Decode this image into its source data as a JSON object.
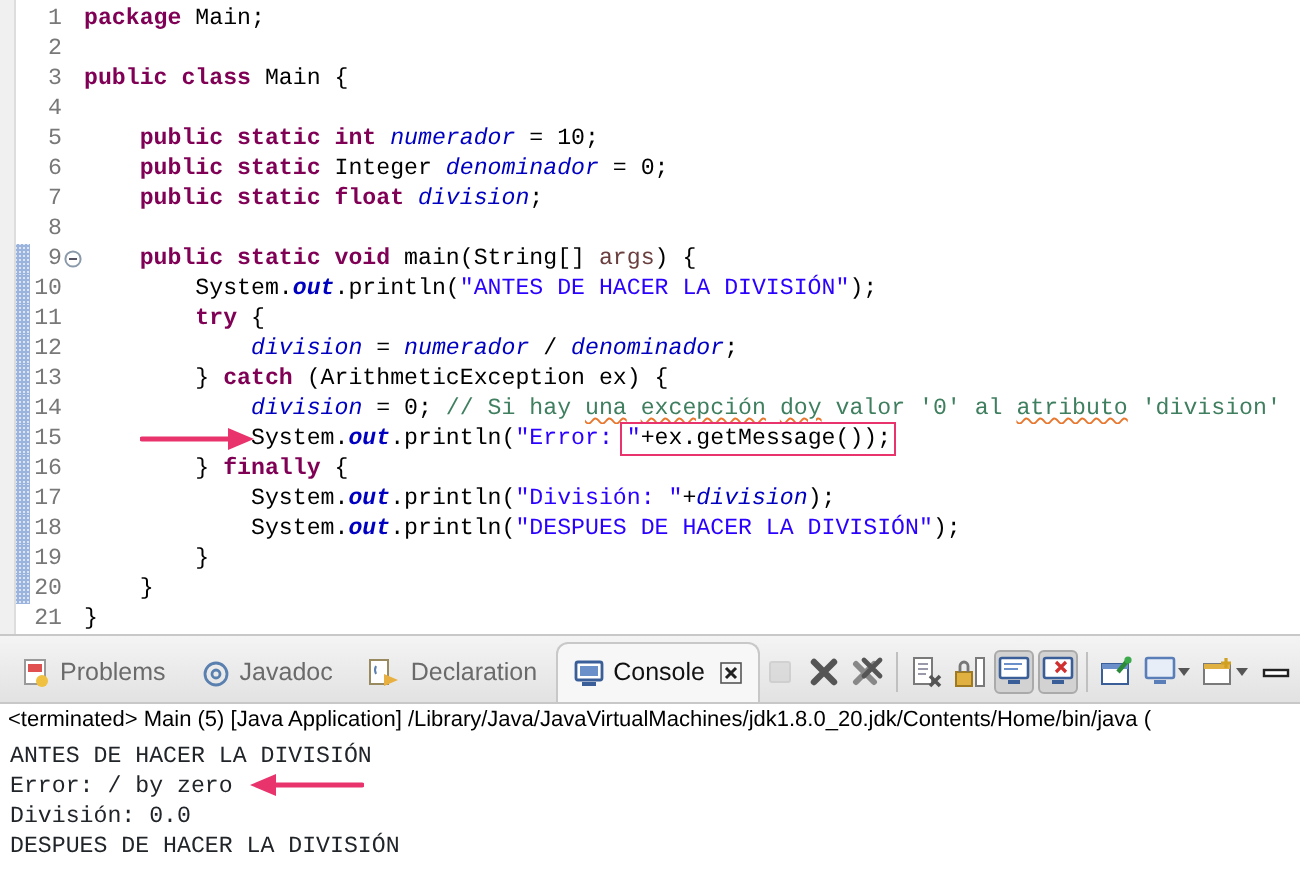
{
  "editor": {
    "lines": [
      {
        "number": "1",
        "marked": false,
        "fold": false,
        "arrow": false,
        "tokens": [
          {
            "text": "package",
            "kind": "keyword"
          },
          {
            "text": " Main;",
            "kind": "plain"
          }
        ]
      },
      {
        "number": "2",
        "marked": false,
        "fold": false,
        "arrow": false
      },
      {
        "number": "3",
        "marked": false,
        "fold": false,
        "arrow": false,
        "tokens": [
          {
            "text": "public class",
            "kind": "keyword"
          },
          {
            "text": " Main {",
            "kind": "plain"
          }
        ]
      },
      {
        "number": "4",
        "marked": false,
        "fold": false,
        "arrow": false
      },
      {
        "number": "5",
        "marked": false,
        "fold": false,
        "arrow": false,
        "tokens": [
          {
            "text": "\tpublic static int",
            "kind": "keyword"
          },
          {
            "text": " numerador",
            "kind": "field"
          },
          {
            "text": " = 10;",
            "kind": "plain"
          }
        ]
      },
      {
        "number": "6",
        "marked": false,
        "fold": false,
        "arrow": false,
        "tokens": [
          {
            "text": "\tpublic static",
            "kind": "keyword"
          },
          {
            "text": " Integer ",
            "kind": "plain"
          },
          {
            "text": "denominador",
            "kind": "field"
          },
          {
            "text": " = 0;",
            "kind": "plain"
          }
        ]
      },
      {
        "number": "7",
        "marked": false,
        "fold": false,
        "arrow": false,
        "tokens": [
          {
            "text": "\tpublic static float",
            "kind": "keyword"
          },
          {
            "text": " division",
            "kind": "field"
          },
          {
            "text": ";",
            "kind": "plain"
          }
        ]
      },
      {
        "number": "8",
        "marked": false,
        "fold": false,
        "arrow": false
      },
      {
        "number": "9",
        "marked": true,
        "fold": true,
        "arrow": false,
        "tokens": [
          {
            "text": "\tpublic static void",
            "kind": "keyword"
          },
          {
            "text": " main(String[] ",
            "kind": "plain"
          },
          {
            "text": "args",
            "kind": "param"
          },
          {
            "text": ") {",
            "kind": "plain"
          }
        ]
      },
      {
        "number": "10",
        "marked": true,
        "fold": false,
        "arrow": false,
        "tokens": [
          {
            "text": "\t\tSystem.",
            "kind": "plain"
          },
          {
            "text": "out",
            "kind": "static"
          },
          {
            "text": ".println(",
            "kind": "plain"
          },
          {
            "text": "\"ANTES DE HACER LA DIVISIÓN\"",
            "kind": "string"
          },
          {
            "text": ");",
            "kind": "plain"
          }
        ]
      },
      {
        "number": "11",
        "marked": true,
        "fold": false,
        "arrow": false,
        "tokens": [
          {
            "text": "\t\ttry",
            "kind": "keyword"
          },
          {
            "text": " {",
            "kind": "plain"
          }
        ]
      },
      {
        "number": "12",
        "marked": true,
        "fold": false,
        "arrow": false,
        "tokens": [
          {
            "text": "\t\t\tdivision",
            "kind": "field"
          },
          {
            "text": " = ",
            "kind": "plain"
          },
          {
            "text": "numerador",
            "kind": "field"
          },
          {
            "text": " / ",
            "kind": "plain"
          },
          {
            "text": "denominador",
            "kind": "field"
          },
          {
            "text": ";",
            "kind": "plain"
          }
        ]
      },
      {
        "number": "13",
        "marked": true,
        "fold": false,
        "arrow": false,
        "tokens": [
          {
            "text": "\t\t} ",
            "kind": "plain"
          },
          {
            "text": "catch",
            "kind": "keyword"
          },
          {
            "text": " (ArithmeticException ex) {",
            "kind": "plain"
          }
        ]
      },
      {
        "number": "14",
        "marked": true,
        "fold": false,
        "arrow": false,
        "tokens": [
          {
            "text": "\t\t\tdivision",
            "kind": "field"
          },
          {
            "text": " = 0; ",
            "kind": "plain"
          },
          {
            "text": "// Si hay ",
            "kind": "comment",
            "misspelled": false
          },
          {
            "text": "una ",
            "kind": "comment",
            "misspelled": true
          },
          {
            "text": "excepción ",
            "kind": "comment",
            "misspelled": true
          },
          {
            "text": "doy",
            "kind": "comment",
            "misspelled": true
          },
          {
            "text": " valor '0' al ",
            "kind": "comment",
            "misspelled": false
          },
          {
            "text": "atributo",
            "kind": "comment",
            "misspelled": true
          },
          {
            "text": " 'division'",
            "kind": "comment",
            "misspelled": false
          }
        ]
      },
      {
        "number": "15",
        "marked": true,
        "fold": false,
        "arrow": true,
        "tokens": [
          {
            "text": "\t\t\tSystem.",
            "kind": "plain"
          },
          {
            "text": "out",
            "kind": "static"
          },
          {
            "text": ".println(",
            "kind": "plain"
          },
          {
            "text": "\"Error: ",
            "kind": "string",
            "boxed": false
          },
          {
            "text": "\"",
            "kind": "string",
            "boxed": true
          },
          {
            "text": "+ex.getMessage());",
            "kind": "plain",
            "boxed": true
          }
        ]
      },
      {
        "number": "16",
        "marked": true,
        "fold": false,
        "arrow": false,
        "tokens": [
          {
            "text": "\t\t} ",
            "kind": "plain"
          },
          {
            "text": "finally",
            "kind": "keyword"
          },
          {
            "text": " {",
            "kind": "plain"
          }
        ]
      },
      {
        "number": "17",
        "marked": true,
        "fold": false,
        "arrow": false,
        "tokens": [
          {
            "text": "\t\t\tSystem.",
            "kind": "plain"
          },
          {
            "text": "out",
            "kind": "static"
          },
          {
            "text": ".println(",
            "kind": "plain"
          },
          {
            "text": "\"División: \"",
            "kind": "string"
          },
          {
            "text": "+",
            "kind": "plain"
          },
          {
            "text": "division",
            "kind": "field"
          },
          {
            "text": ");",
            "kind": "plain"
          }
        ]
      },
      {
        "number": "18",
        "marked": true,
        "fold": false,
        "arrow": false,
        "tokens": [
          {
            "text": "\t\t\tSystem.",
            "kind": "plain"
          },
          {
            "text": "out",
            "kind": "static"
          },
          {
            "text": ".println(",
            "kind": "plain"
          },
          {
            "text": "\"DESPUES DE HACER LA DIVISIÓN\"",
            "kind": "string"
          },
          {
            "text": ");",
            "kind": "plain"
          }
        ]
      },
      {
        "number": "19",
        "marked": true,
        "fold": false,
        "arrow": false,
        "tokens": [
          {
            "text": "\t\t}",
            "kind": "plain"
          }
        ]
      },
      {
        "number": "20",
        "marked": true,
        "fold": false,
        "arrow": false,
        "tokens": [
          {
            "text": "\t}",
            "kind": "plain"
          }
        ]
      },
      {
        "number": "21",
        "marked": false,
        "fold": false,
        "arrow": false,
        "tokens": [
          {
            "text": "}",
            "kind": "plain"
          }
        ]
      }
    ]
  },
  "tabs": [
    {
      "label": "Problems",
      "kind": "problems",
      "selected": false
    },
    {
      "label": "Javadoc",
      "kind": "javadoc",
      "selected": false
    },
    {
      "label": "Declaration",
      "kind": "declaration",
      "selected": false
    },
    {
      "label": "Console",
      "kind": "console",
      "selected": true
    }
  ],
  "toolbar": [
    {
      "kind": "stop",
      "disabled": true,
      "pressed": false,
      "dropdown": false
    },
    {
      "kind": "remove",
      "disabled": false,
      "pressed": false,
      "dropdown": false
    },
    {
      "kind": "remove_all",
      "disabled": false,
      "pressed": false,
      "dropdown": false
    },
    {
      "kind": "clear",
      "disabled": false,
      "pressed": false,
      "dropdown": false
    },
    {
      "kind": "scroll_lock",
      "disabled": false,
      "pressed": false,
      "dropdown": false
    },
    {
      "kind": "show_out",
      "disabled": false,
      "pressed": true,
      "dropdown": false
    },
    {
      "kind": "show_err",
      "disabled": false,
      "pressed": true,
      "dropdown": false
    },
    {
      "kind": "pin",
      "disabled": false,
      "pressed": false,
      "dropdown": false
    },
    {
      "kind": "display",
      "disabled": false,
      "pressed": false,
      "dropdown": true
    },
    {
      "kind": "open",
      "disabled": false,
      "pressed": false,
      "dropdown": true
    },
    {
      "kind": "minimize",
      "disabled": false,
      "pressed": false,
      "dropdown": false
    }
  ],
  "console": {
    "header": "<terminated> Main (5) [Java Application] /Library/Java/JavaVirtualMachines/jdk1.8.0_20.jdk/Contents/Home/bin/java (",
    "lines": [
      {
        "text": "ANTES DE HACER LA DIVISIÓN",
        "arrow": false
      },
      {
        "text": "Error: / by zero",
        "arrow": true
      },
      {
        "text": "División: 0.0",
        "arrow": false
      },
      {
        "text": "DESPUES DE HACER LA DIVISIÓN",
        "arrow": false
      }
    ]
  }
}
